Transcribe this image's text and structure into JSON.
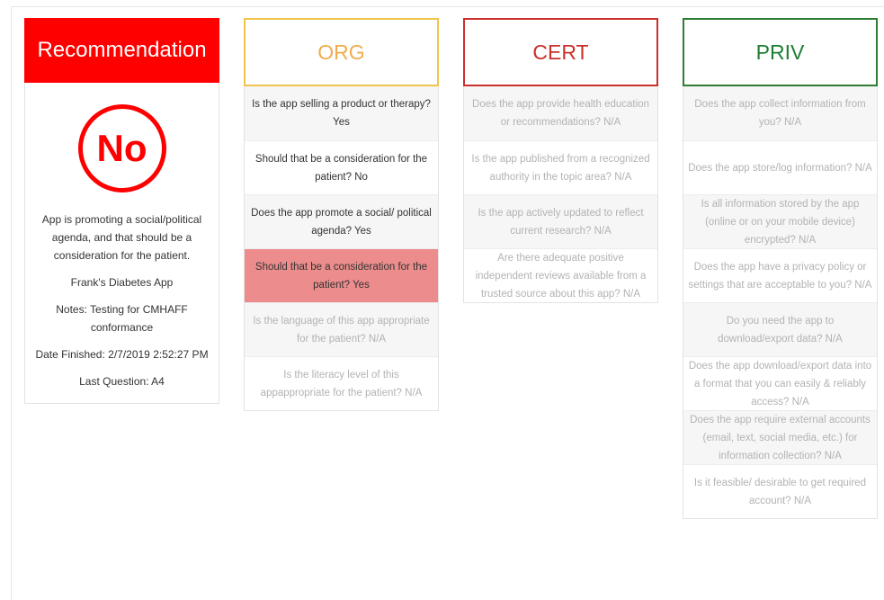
{
  "recommendation": {
    "header": "Recommendation",
    "verdict": "No",
    "reason": "App is promoting a social/political agenda, and that should be a consideration for the patient.",
    "app_name": "Frank's Diabetes App",
    "notes": "Notes: Testing for CMHAFF conformance",
    "date_finished": "Date Finished: 2/7/2019 2:52:27 PM",
    "last_question": "Last Question: A4"
  },
  "org": {
    "header": "ORG",
    "questions": [
      "Is the app selling a product or therapy? Yes",
      "Should that be a consideration for the patient? No",
      "Does the app promote a social/ political agenda? Yes",
      "Should that be a consideration for the patient? Yes",
      "Is the language of this app appropriate for the patient? N/A",
      "Is the literacy level of this appappropriate for the patient? N/A"
    ]
  },
  "cert": {
    "header": "CERT",
    "questions": [
      "Does the app provide health education or recommendations? N/A",
      "Is the app published from a recognized authority in the topic area? N/A",
      "Is the app actively updated to reflect current research? N/A",
      "Are there adequate positive independent reviews available from a trusted source about this app? N/A"
    ]
  },
  "priv": {
    "header": "PRIV",
    "questions": [
      "Does the app collect information from you? N/A",
      "Does the app store/log information? N/A",
      "Is all information stored by the app (online or on your mobile device) encrypted? N/A",
      "Does the app have a privacy policy or settings that are acceptable to you? N/A",
      "Do you need the app to download/export data? N/A",
      "Does the app download/export data into a format that you can easily & reliably access? N/A",
      "Does the app require external accounts (email, text, social media, etc.) for information collection? N/A",
      "Is it feasible/ desirable to get required account? N/A"
    ]
  },
  "colors": {
    "recommendation": "#ff0000",
    "org": "#f0ad4e",
    "cert": "#c9302c",
    "priv": "#1e7e34",
    "highlight": "#ec8c8c"
  }
}
